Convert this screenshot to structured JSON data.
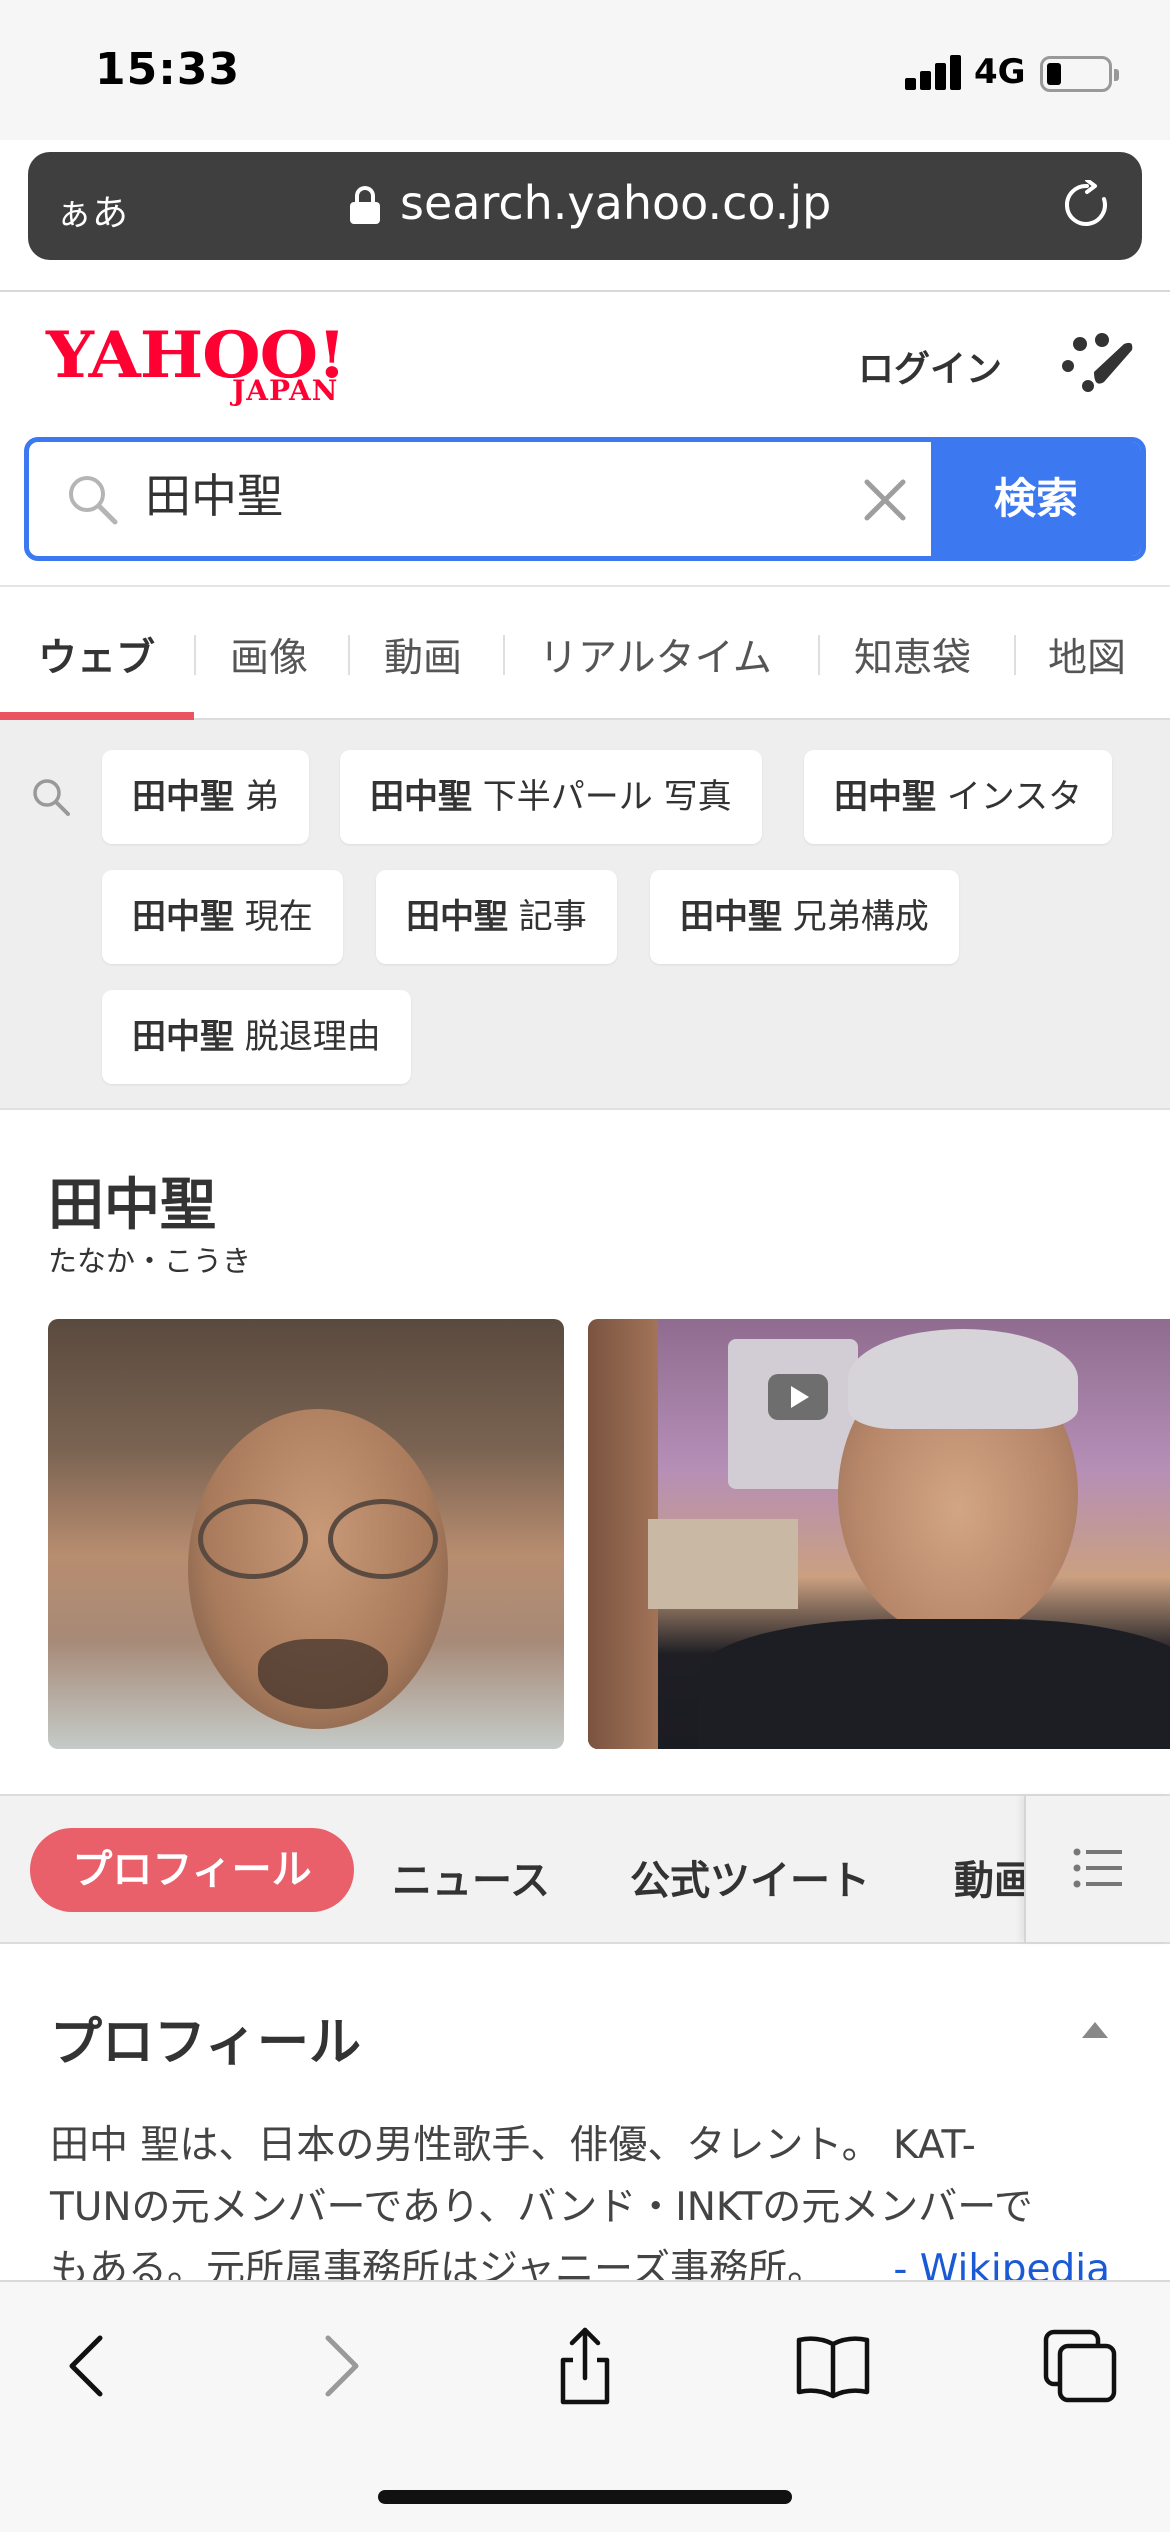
{
  "status_bar": {
    "time": "15:33",
    "network": "4G"
  },
  "url_bar": {
    "text_size_label": "ぁあ",
    "url": "search.yahoo.co.jp"
  },
  "header": {
    "logo_main": "YAHOO!",
    "logo_sub": "JAPAN",
    "login_label": "ログイン"
  },
  "search": {
    "query": "田中聖",
    "button_label": "検索"
  },
  "tabs": [
    "ウェブ",
    "画像",
    "動画",
    "リアルタイム",
    "知恵袋",
    "地図"
  ],
  "suggestions": [
    {
      "bold": "田中聖",
      "rest": " 弟"
    },
    {
      "bold": "田中聖",
      "rest": " 下半パール 写真"
    },
    {
      "bold": "田中聖",
      "rest": " インスタ"
    },
    {
      "bold": "田中聖",
      "rest": " 現在"
    },
    {
      "bold": "田中聖",
      "rest": " 記事"
    },
    {
      "bold": "田中聖",
      "rest": " 兄弟構成"
    },
    {
      "bold": "田中聖",
      "rest": " 脱退理由"
    }
  ],
  "knowledge_panel": {
    "name": "田中聖",
    "reading": "たなか・こうき"
  },
  "panel_tabs": [
    "プロフィール",
    "ニュース",
    "公式ツイート",
    "動画"
  ],
  "profile": {
    "title": "プロフィール",
    "line1": "田中 聖は、日本の男性歌手、俳優、タレント。 KAT-",
    "line2": "TUNの元メンバーであり、バンド・INKTの元メンバーで",
    "line3": "もある。元所属事務所はジャニーズ事務所。",
    "source": "- Wikipedia"
  },
  "colors": {
    "accent_blue": "#3c78f0",
    "accent_red": "#e95f6a",
    "brand_red": "#ff0033"
  }
}
